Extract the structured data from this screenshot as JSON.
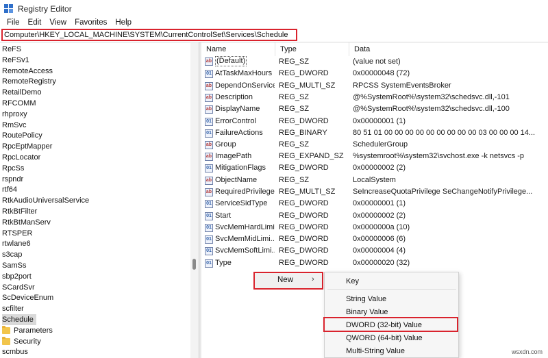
{
  "window": {
    "title": "Registry Editor"
  },
  "menu": [
    "File",
    "Edit",
    "View",
    "Favorites",
    "Help"
  ],
  "address": "Computer\\HKEY_LOCAL_MACHINE\\SYSTEM\\CurrentControlSet\\Services\\Schedule",
  "tree": {
    "items": [
      "ReFS",
      "ReFSv1",
      "RemoteAccess",
      "RemoteRegistry",
      "RetailDemo",
      "RFCOMM",
      "rhproxy",
      "RmSvc",
      "RoutePolicy",
      "RpcEptMapper",
      "RpcLocator",
      "RpcSs",
      "rspndr",
      "rtf64",
      "RtkAudioUniversalService",
      "RtkBtFilter",
      "RtkBtManServ",
      "RTSPER",
      "rtwlane6",
      "s3cap",
      "SamSs",
      "sbp2port",
      "SCardSvr",
      "ScDeviceEnum",
      "scfilter",
      "Schedule"
    ],
    "selected": "Schedule",
    "children": [
      "Parameters",
      "Security"
    ],
    "after": "scmbus"
  },
  "columns": {
    "name": "Name",
    "type": "Type",
    "data": "Data"
  },
  "values": [
    {
      "name": "(Default)",
      "type": "REG_SZ",
      "data": "(value not set)",
      "icon": "string-value-icon"
    },
    {
      "name": "AtTaskMaxHours",
      "type": "REG_DWORD",
      "data": "0x00000048 (72)",
      "icon": "binary-value-icon"
    },
    {
      "name": "DependOnService",
      "type": "REG_MULTI_SZ",
      "data": "RPCSS SystemEventsBroker",
      "icon": "string-value-icon"
    },
    {
      "name": "Description",
      "type": "REG_SZ",
      "data": "@%SystemRoot%\\system32\\schedsvc.dll,-101",
      "icon": "string-value-icon"
    },
    {
      "name": "DisplayName",
      "type": "REG_SZ",
      "data": "@%SystemRoot%\\system32\\schedsvc.dll,-100",
      "icon": "string-value-icon"
    },
    {
      "name": "ErrorControl",
      "type": "REG_DWORD",
      "data": "0x00000001 (1)",
      "icon": "binary-value-icon"
    },
    {
      "name": "FailureActions",
      "type": "REG_BINARY",
      "data": "80 51 01 00 00 00 00 00 00 00 00 00 03 00 00 00 14...",
      "icon": "binary-value-icon"
    },
    {
      "name": "Group",
      "type": "REG_SZ",
      "data": "SchedulerGroup",
      "icon": "string-value-icon"
    },
    {
      "name": "ImagePath",
      "type": "REG_EXPAND_SZ",
      "data": "%systemroot%\\system32\\svchost.exe -k netsvcs -p",
      "icon": "string-value-icon"
    },
    {
      "name": "MitigationFlags",
      "type": "REG_DWORD",
      "data": "0x00000002 (2)",
      "icon": "binary-value-icon"
    },
    {
      "name": "ObjectName",
      "type": "REG_SZ",
      "data": "LocalSystem",
      "icon": "string-value-icon"
    },
    {
      "name": "RequiredPrivilege...",
      "type": "REG_MULTI_SZ",
      "data": "SeIncreaseQuotaPrivilege SeChangeNotifyPrivilege...",
      "icon": "string-value-icon"
    },
    {
      "name": "ServiceSidType",
      "type": "REG_DWORD",
      "data": "0x00000001 (1)",
      "icon": "binary-value-icon"
    },
    {
      "name": "Start",
      "type": "REG_DWORD",
      "data": "0x00000002 (2)",
      "icon": "binary-value-icon"
    },
    {
      "name": "SvcMemHardLimi...",
      "type": "REG_DWORD",
      "data": "0x0000000a (10)",
      "icon": "binary-value-icon"
    },
    {
      "name": "SvcMemMidLimi...",
      "type": "REG_DWORD",
      "data": "0x00000006 (6)",
      "icon": "binary-value-icon"
    },
    {
      "name": "SvcMemSoftLimi...",
      "type": "REG_DWORD",
      "data": "0x00000004 (4)",
      "icon": "binary-value-icon"
    },
    {
      "name": "Type",
      "type": "REG_DWORD",
      "data": "0x00000020 (32)",
      "icon": "binary-value-icon"
    }
  ],
  "context_menu": {
    "new_label": "New",
    "arrow": "›"
  },
  "submenu": {
    "key": "Key",
    "items": [
      "String Value",
      "Binary Value",
      "DWORD (32-bit) Value",
      "QWORD (64-bit) Value",
      "Multi-String Value"
    ]
  },
  "watermark": "wsxdn.com",
  "colors": {
    "highlight": "#d9232d",
    "folder": "#f2c54b",
    "selection": "#d9d9d9"
  }
}
